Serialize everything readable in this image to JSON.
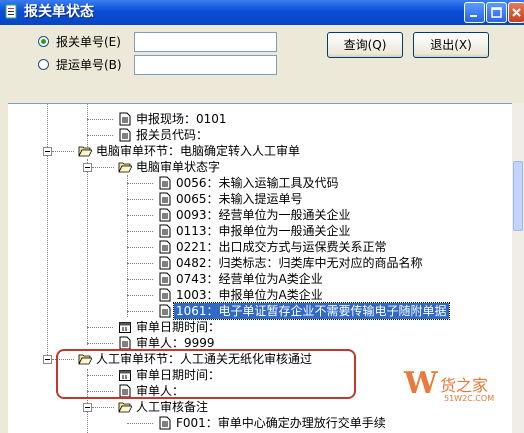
{
  "window": {
    "title": "报关单状态",
    "controls": {
      "minimize": "_",
      "maximize": "□",
      "close": "×"
    }
  },
  "form": {
    "radio_customs_label": "报关单号(E)",
    "radio_bill_label": "提运单号(B)",
    "customs_value": "",
    "bill_value": "",
    "query_label": "查询(Q)",
    "exit_label": "退出(X)"
  },
  "tree": {
    "n0": "申报现场：0101",
    "n1": "报关员代码：",
    "n2": "电脑审单环节：电脑确定转入人工审单",
    "n3": "电脑审单状态字",
    "n4": "0056：未输入运输工具及代码",
    "n5": "0065：未输入提运单号",
    "n6": "0093：经营单位为一般通关企业",
    "n7": "0113：申报单位为一般通关企业",
    "n8": "0221：出口成交方式与运保费关系正常",
    "n9": "0482：归类标志：归类库中无对应的商品名称",
    "n10": "0743：经营单位为A类企业",
    "n11": "1003：申报单位为A类企业",
    "n12": "1061：电子单证暂存企业不需要传输电子随附单据",
    "n13": "审单日期时间：",
    "n14": "审单人：9999",
    "n15": "人工审单环节：人工通关无纸化审核通过",
    "n16": "审单日期时间：",
    "n17": "审单人：",
    "n18": "人工审核备注",
    "n19": "F001：审单中心确定办理放行交单手续"
  },
  "watermark": {
    "mark": "W",
    "text": "货之家",
    "url": "51W2C.COM"
  },
  "colors": {
    "titlebar": "#0a4fd8",
    "selection": "#316ac5",
    "highlight_border": "#c0392b",
    "watermark": "#e87a3a"
  }
}
